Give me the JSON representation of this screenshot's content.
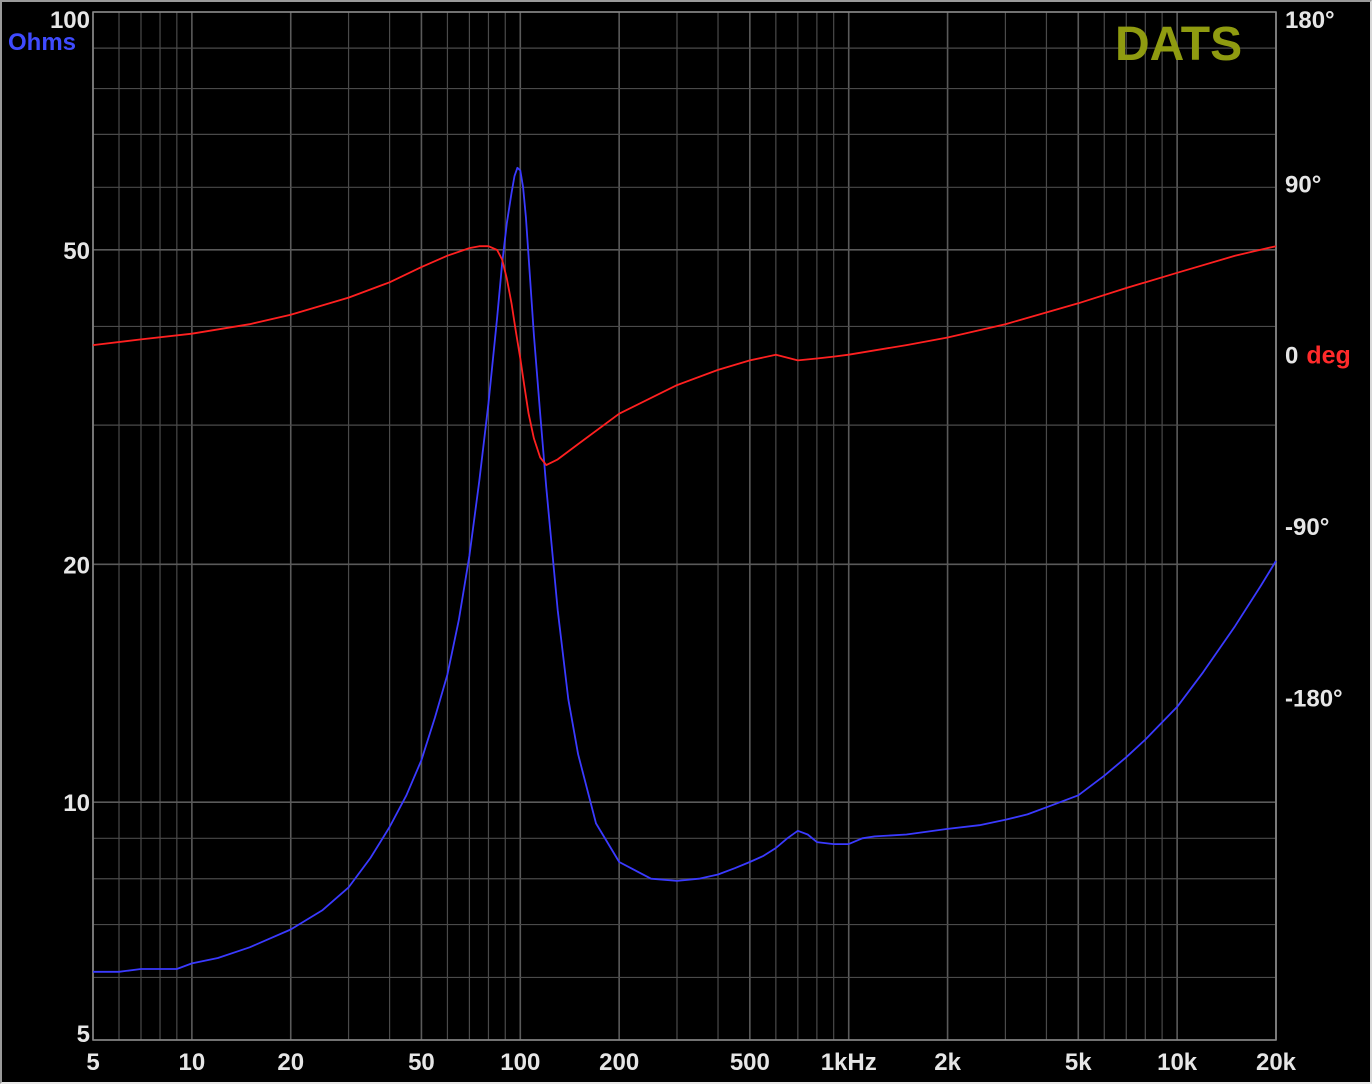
{
  "chart_data": {
    "type": "line",
    "title": "",
    "brand": "DATS",
    "xscale": "log",
    "yscale": "log",
    "xlim": [
      5,
      20000
    ],
    "ylim": [
      5,
      100
    ],
    "y2lim": [
      -360,
      180
    ],
    "grid": true,
    "x_ticks": [
      {
        "v": 5,
        "label": "5"
      },
      {
        "v": 10,
        "label": "10"
      },
      {
        "v": 20,
        "label": "20"
      },
      {
        "v": 50,
        "label": "50"
      },
      {
        "v": 100,
        "label": "100"
      },
      {
        "v": 200,
        "label": "200"
      },
      {
        "v": 500,
        "label": "500"
      },
      {
        "v": 1000,
        "label": "1kHz"
      },
      {
        "v": 2000,
        "label": "2k"
      },
      {
        "v": 5000,
        "label": "5k"
      },
      {
        "v": 10000,
        "label": "10k"
      },
      {
        "v": 20000,
        "label": "20k"
      }
    ],
    "y_ticks": [
      {
        "v": 100,
        "label": "100"
      },
      {
        "v": 50,
        "label": "50"
      },
      {
        "v": 20,
        "label": "20"
      },
      {
        "v": 10,
        "label": "10"
      },
      {
        "v": 5,
        "label": "5"
      }
    ],
    "y_label": "Ohms",
    "y2_ticks": [
      {
        "v": 180,
        "label": "180°"
      },
      {
        "v": 90,
        "label": "90°"
      },
      {
        "v": 0,
        "label": "0"
      },
      {
        "v": -90,
        "label": "-90°"
      },
      {
        "v": -180,
        "label": "-180°"
      }
    ],
    "y2_label": "deg",
    "colors": {
      "impedance": "#3a3aff",
      "phase": "#ff2020",
      "grid": "#4a4a4a",
      "brand": "#8f9b10"
    },
    "series": [
      {
        "key": "impedance",
        "axis": "left",
        "x": [
          5,
          6,
          7,
          8,
          9,
          10,
          12,
          15,
          20,
          25,
          30,
          35,
          40,
          45,
          50,
          55,
          60,
          65,
          70,
          75,
          80,
          85,
          88,
          91,
          94,
          96,
          98,
          100,
          102,
          104,
          106,
          110,
          115,
          120,
          130,
          140,
          150,
          170,
          200,
          250,
          300,
          350,
          400,
          450,
          500,
          550,
          600,
          650,
          700,
          750,
          800,
          900,
          1000,
          1100,
          1200,
          1500,
          2000,
          2500,
          3000,
          3500,
          4000,
          5000,
          6000,
          7000,
          8000,
          10000,
          12000,
          15000,
          18000,
          20000
        ],
        "y": [
          6.1,
          6.1,
          6.15,
          6.15,
          6.15,
          6.25,
          6.35,
          6.55,
          6.9,
          7.3,
          7.8,
          8.5,
          9.3,
          10.2,
          11.3,
          12.8,
          14.5,
          17.0,
          20.5,
          25.5,
          32.0,
          41.0,
          48.0,
          54.0,
          59.0,
          62.0,
          63.5,
          63.0,
          60.0,
          55.0,
          49.0,
          39.0,
          31.0,
          25.0,
          17.5,
          13.5,
          11.5,
          9.4,
          8.4,
          8.0,
          7.95,
          8.0,
          8.1,
          8.25,
          8.4,
          8.55,
          8.75,
          9.0,
          9.2,
          9.1,
          8.9,
          8.85,
          8.85,
          9.0,
          9.05,
          9.1,
          9.25,
          9.35,
          9.5,
          9.65,
          9.85,
          10.2,
          10.8,
          11.4,
          12.0,
          13.2,
          14.6,
          16.7,
          18.8,
          20.2
        ]
      },
      {
        "key": "phase",
        "axis": "right",
        "x": [
          5,
          7,
          10,
          15,
          20,
          30,
          40,
          50,
          60,
          70,
          75,
          80,
          85,
          88,
          91,
          94,
          97,
          100,
          103,
          106,
          110,
          115,
          120,
          130,
          150,
          200,
          300,
          400,
          500,
          600,
          700,
          800,
          900,
          1000,
          1500,
          2000,
          3000,
          5000,
          7000,
          10000,
          15000,
          20000
        ],
        "y": [
          5,
          8,
          11,
          16,
          21,
          30,
          38,
          46,
          52,
          56,
          57,
          57,
          55,
          50,
          40,
          27,
          12,
          -2,
          -17,
          -31,
          -44,
          -54,
          -58,
          -55,
          -47,
          -31,
          -16,
          -8,
          -3,
          0,
          -3,
          -2,
          -1,
          0,
          5,
          9,
          16,
          27,
          35,
          43,
          52,
          57
        ]
      }
    ]
  }
}
